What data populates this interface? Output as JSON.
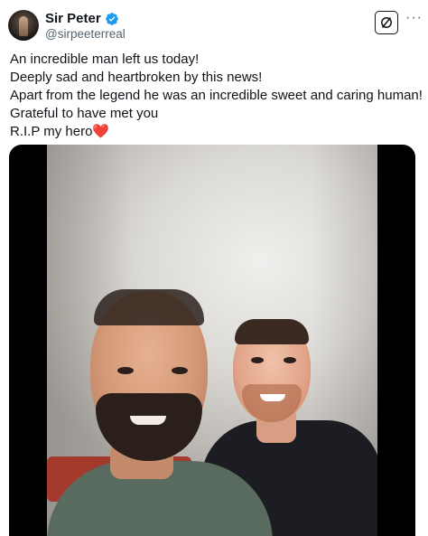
{
  "author": {
    "display_name": "Sir Peter",
    "handle": "@sirpeeterreal",
    "verified": true,
    "verified_color": "#1d9bf0"
  },
  "actions": {
    "grok_icon": "grok-icon",
    "more_icon": "more-horizontal-icon"
  },
  "tweet": {
    "lines": [
      "An incredible man left us today!",
      "Deeply sad and heartbroken by this news!",
      "Apart from the legend he was an incredible sweet and caring human!",
      "Grateful to have met you",
      "R.I.P my hero"
    ],
    "emoji": "❤️"
  },
  "media": {
    "type": "video-thumbnail",
    "accent": "#000000"
  }
}
